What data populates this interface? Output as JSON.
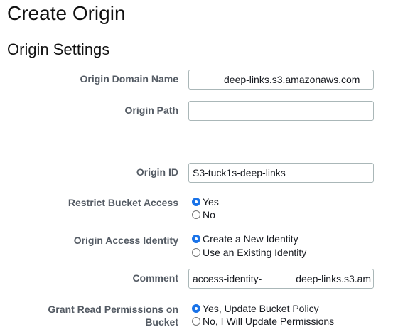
{
  "page": {
    "title": "Create Origin",
    "section_title": "Origin Settings"
  },
  "fields": {
    "origin_domain_name": {
      "label": "Origin Domain Name",
      "value": "deep-links.s3.amazonaws.com"
    },
    "origin_path": {
      "label": "Origin Path",
      "value": ""
    },
    "origin_id": {
      "label": "Origin ID",
      "value": "S3-tuck1s-deep-links"
    },
    "restrict_bucket_access": {
      "label": "Restrict Bucket Access",
      "options": [
        {
          "label": "Yes",
          "selected": true
        },
        {
          "label": "No",
          "selected": false
        }
      ]
    },
    "origin_access_identity": {
      "label": "Origin Access Identity",
      "options": [
        {
          "label": "Create a New Identity",
          "selected": true
        },
        {
          "label": "Use an Existing Identity",
          "selected": false
        }
      ]
    },
    "comment": {
      "label": "Comment",
      "value_prefix": "access-identity-",
      "value_suffix": "deep-links.s3.am"
    },
    "grant_read_permissions": {
      "label_line1": "Grant Read Permissions on",
      "label_line2": "Bucket",
      "options": [
        {
          "label": "Yes, Update Bucket Policy",
          "selected": true
        },
        {
          "label": "No, I Will Update Permissions",
          "selected": false
        }
      ]
    }
  },
  "colors": {
    "label_text": "#545b64",
    "input_border": "#aab7b8",
    "radio_selected": "#1a73e8"
  }
}
